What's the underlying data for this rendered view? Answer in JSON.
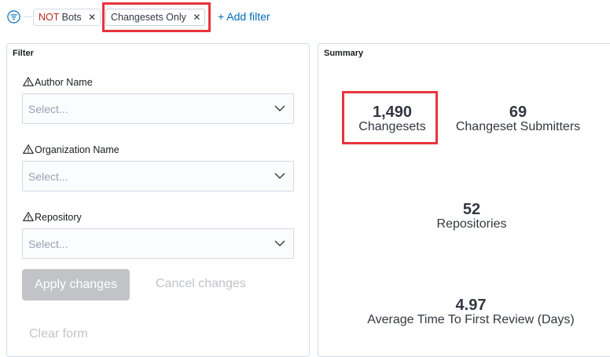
{
  "filter_bar": {
    "pills": [
      {
        "negation": "NOT",
        "label": "Bots",
        "remove_icon": "close-icon"
      },
      {
        "label": "Changesets Only",
        "remove_icon": "close-icon"
      }
    ],
    "add_filter_label": "+ Add filter",
    "highlight_color": "#e8343c"
  },
  "filter_panel": {
    "title": "Filter",
    "fields": [
      {
        "label": "Author Name",
        "placeholder": "Select...",
        "icon": "warning-icon"
      },
      {
        "label": "Organization Name",
        "placeholder": "Select...",
        "icon": "warning-icon"
      },
      {
        "label": "Repository",
        "placeholder": "Select...",
        "icon": "warning-icon"
      }
    ],
    "apply_label": "Apply changes",
    "cancel_label": "Cancel changes",
    "clear_label": "Clear form"
  },
  "summary_panel": {
    "title": "Summary",
    "stats": {
      "changesets": {
        "value": "1,490",
        "label": "Changesets"
      },
      "submitters": {
        "value": "69",
        "label": "Changeset Submitters"
      },
      "repositories": {
        "value": "52",
        "label": "Repositories"
      },
      "review_time": {
        "value": "4.97",
        "label": "Average Time To First Review (Days)"
      }
    }
  },
  "colors": {
    "accent_link": "#006bb8",
    "negation": "#bd271e",
    "disabled": "#c2c3c6",
    "border": "#d3dae6"
  }
}
